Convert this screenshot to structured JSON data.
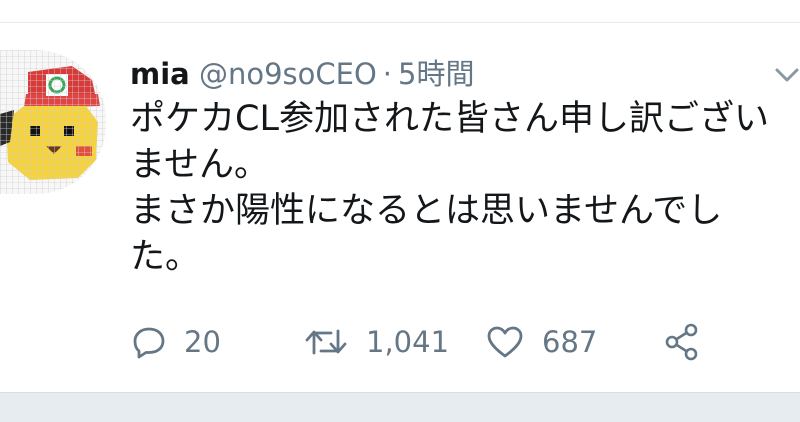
{
  "tweet": {
    "author_name": "mia",
    "author_handle": "@no9soCEO",
    "separator": "·",
    "timestamp": "5時間",
    "text": "ポケカCL参加された皆さん申し訳ございません。\nまさか陽性になるとは思いませんでした。"
  },
  "actions": {
    "reply_count": "20",
    "retweet_count": "1,041",
    "like_count": "687"
  },
  "icons": {
    "reply": "reply-icon",
    "retweet": "retweet-icon",
    "like": "heart-icon",
    "share": "share-icon",
    "menu": "chevron-down-icon"
  },
  "colors": {
    "text_primary": "#14171a",
    "text_secondary": "#657786",
    "divider": "#e6ecf0"
  }
}
